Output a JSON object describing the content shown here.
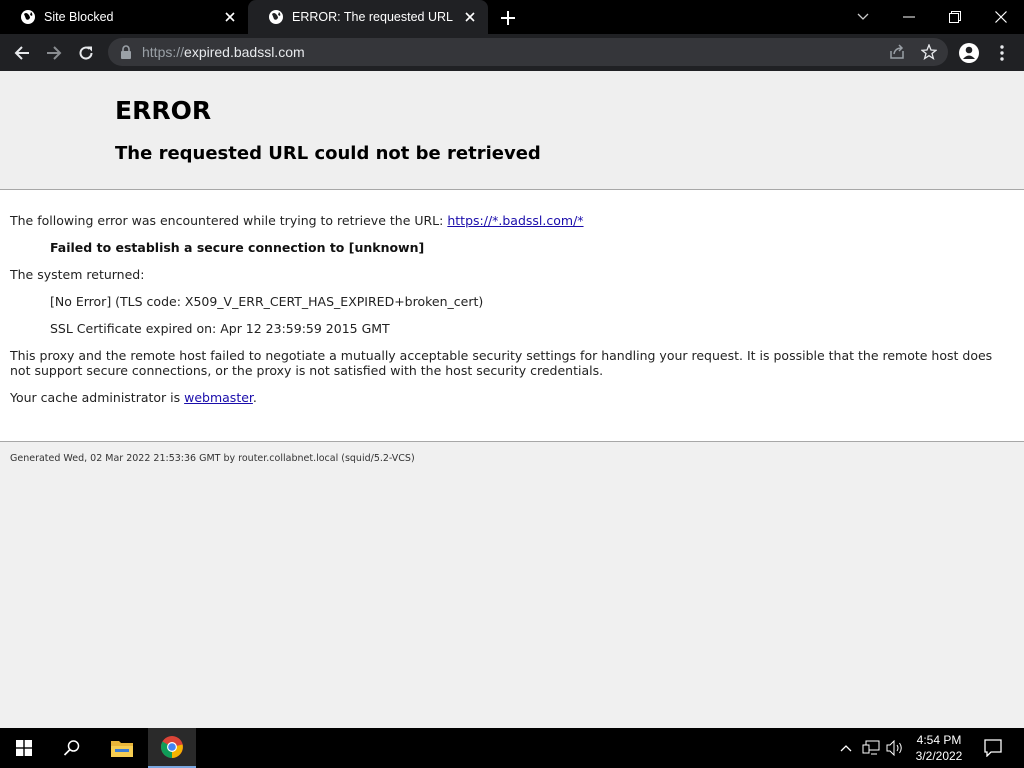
{
  "tabs": [
    {
      "title": "Site Blocked",
      "active": false
    },
    {
      "title": "ERROR: The requested URL could not be retrieved",
      "active": true
    }
  ],
  "address_bar": {
    "scheme": "https://",
    "host": "expired.badssl.com"
  },
  "page": {
    "heading": "ERROR",
    "subheading": "The requested URL could not be retrieved",
    "intro_text": "The following error was encountered while trying to retrieve the URL: ",
    "requested_url": "https://*.badssl.com/*",
    "error_detail": "Failed to establish a secure connection to [unknown]",
    "system_returned_label": "The system returned:",
    "tls_code": "[No Error] (TLS code: X509_V_ERR_CERT_HAS_EXPIRED+broken_cert)",
    "cert_expiry": "SSL Certificate expired on: Apr 12 23:59:59 2015 GMT",
    "explanation": "This proxy and the remote host failed to negotiate a mutually acceptable security settings for handling your request. It is possible that the remote host does not support secure connections, or the proxy is not satisfied with the host security credentials.",
    "admin_prefix": "Your cache administrator is ",
    "admin_link": "webmaster",
    "admin_suffix": ".",
    "footer": "Generated Wed, 02 Mar 2022 21:53:36 GMT by router.collabnet.local (squid/5.2-VCS)"
  },
  "taskbar": {
    "time": "4:54 PM",
    "date": "3/2/2022"
  },
  "colors": {
    "tab_active": "#202124",
    "link": "#1a0dab",
    "page_bg": "#f0f0f0"
  }
}
